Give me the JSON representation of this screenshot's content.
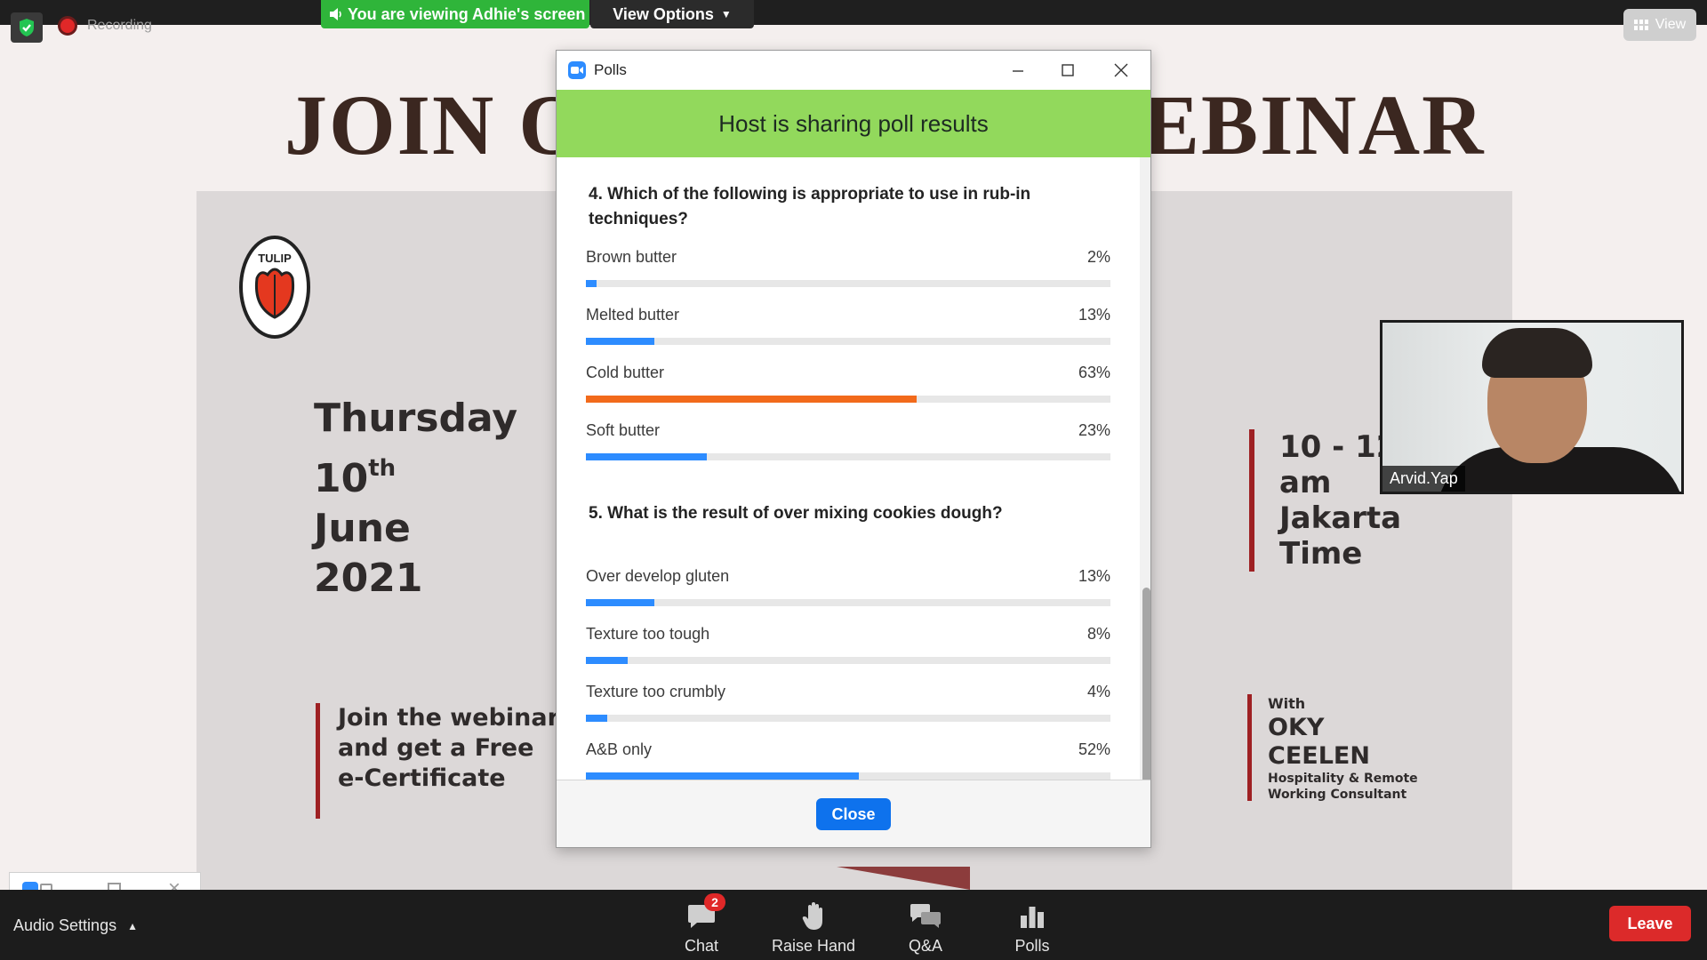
{
  "topbar": {
    "recording_label": "Recording",
    "viewing_banner": "You are viewing Adhie's screen",
    "view_options_label": "View Options",
    "view_button_label": "View"
  },
  "slide": {
    "title_left": "JOIN OU",
    "title_right": "EBINAR",
    "date_lines": [
      "Thursday",
      "10",
      "th",
      "June",
      "2021"
    ],
    "join_lines": [
      "Join the webinar",
      "and get a Free",
      "e-Certificate"
    ],
    "time_lines": [
      "10 - 12",
      "am",
      "Jakarta",
      "Time"
    ],
    "with_label": "With",
    "presenter_lines": [
      "OKY",
      "CEELEN"
    ],
    "role_lines": [
      "Hospitality & Remote",
      "Working Consultant"
    ],
    "logo_text": "TULIP"
  },
  "video_tile": {
    "participant_name": "Arvid.Yap"
  },
  "polls": {
    "window_title": "Polls",
    "banner": "Host is sharing poll results",
    "questions": [
      {
        "text": "4. Which of the following is appropriate to use in rub-in techniques?",
        "options": [
          {
            "label": "Brown butter",
            "pct_label": "2%",
            "value": 2
          },
          {
            "label": "Melted butter",
            "pct_label": "13%",
            "value": 13
          },
          {
            "label": "Cold butter",
            "pct_label": "63%",
            "value": 63
          },
          {
            "label": "Soft butter",
            "pct_label": "23%",
            "value": 23
          }
        ]
      },
      {
        "text": "5. What is the result of over mixing cookies dough?",
        "options": [
          {
            "label": "Over develop gluten",
            "pct_label": "13%",
            "value": 13
          },
          {
            "label": "Texture too tough",
            "pct_label": "8%",
            "value": 8
          },
          {
            "label": "Texture too crumbly",
            "pct_label": "4%",
            "value": 4
          },
          {
            "label": "A&B only",
            "pct_label": "52%",
            "value": 52
          }
        ]
      }
    ],
    "close_label": "Close",
    "colors": {
      "bar": "#2d8cff",
      "bar_top": "#f26a1b",
      "banner": "#92d95c"
    }
  },
  "toolbar": {
    "audio_settings_label": "Audio Settings",
    "chat_label": "Chat",
    "chat_badge": "2",
    "raise_hand_label": "Raise Hand",
    "qa_label": "Q&A",
    "polls_label": "Polls",
    "leave_label": "Leave"
  },
  "icons": [
    "shield-check-icon",
    "recording-icon",
    "speaker-icon",
    "chevron-down-icon",
    "grid-view-icon",
    "zoom-logo-icon",
    "minimize-icon",
    "maximize-icon",
    "close-icon",
    "chevron-up-icon",
    "chat-icon",
    "raise-hand-icon",
    "qa-icon",
    "polls-icon"
  ]
}
